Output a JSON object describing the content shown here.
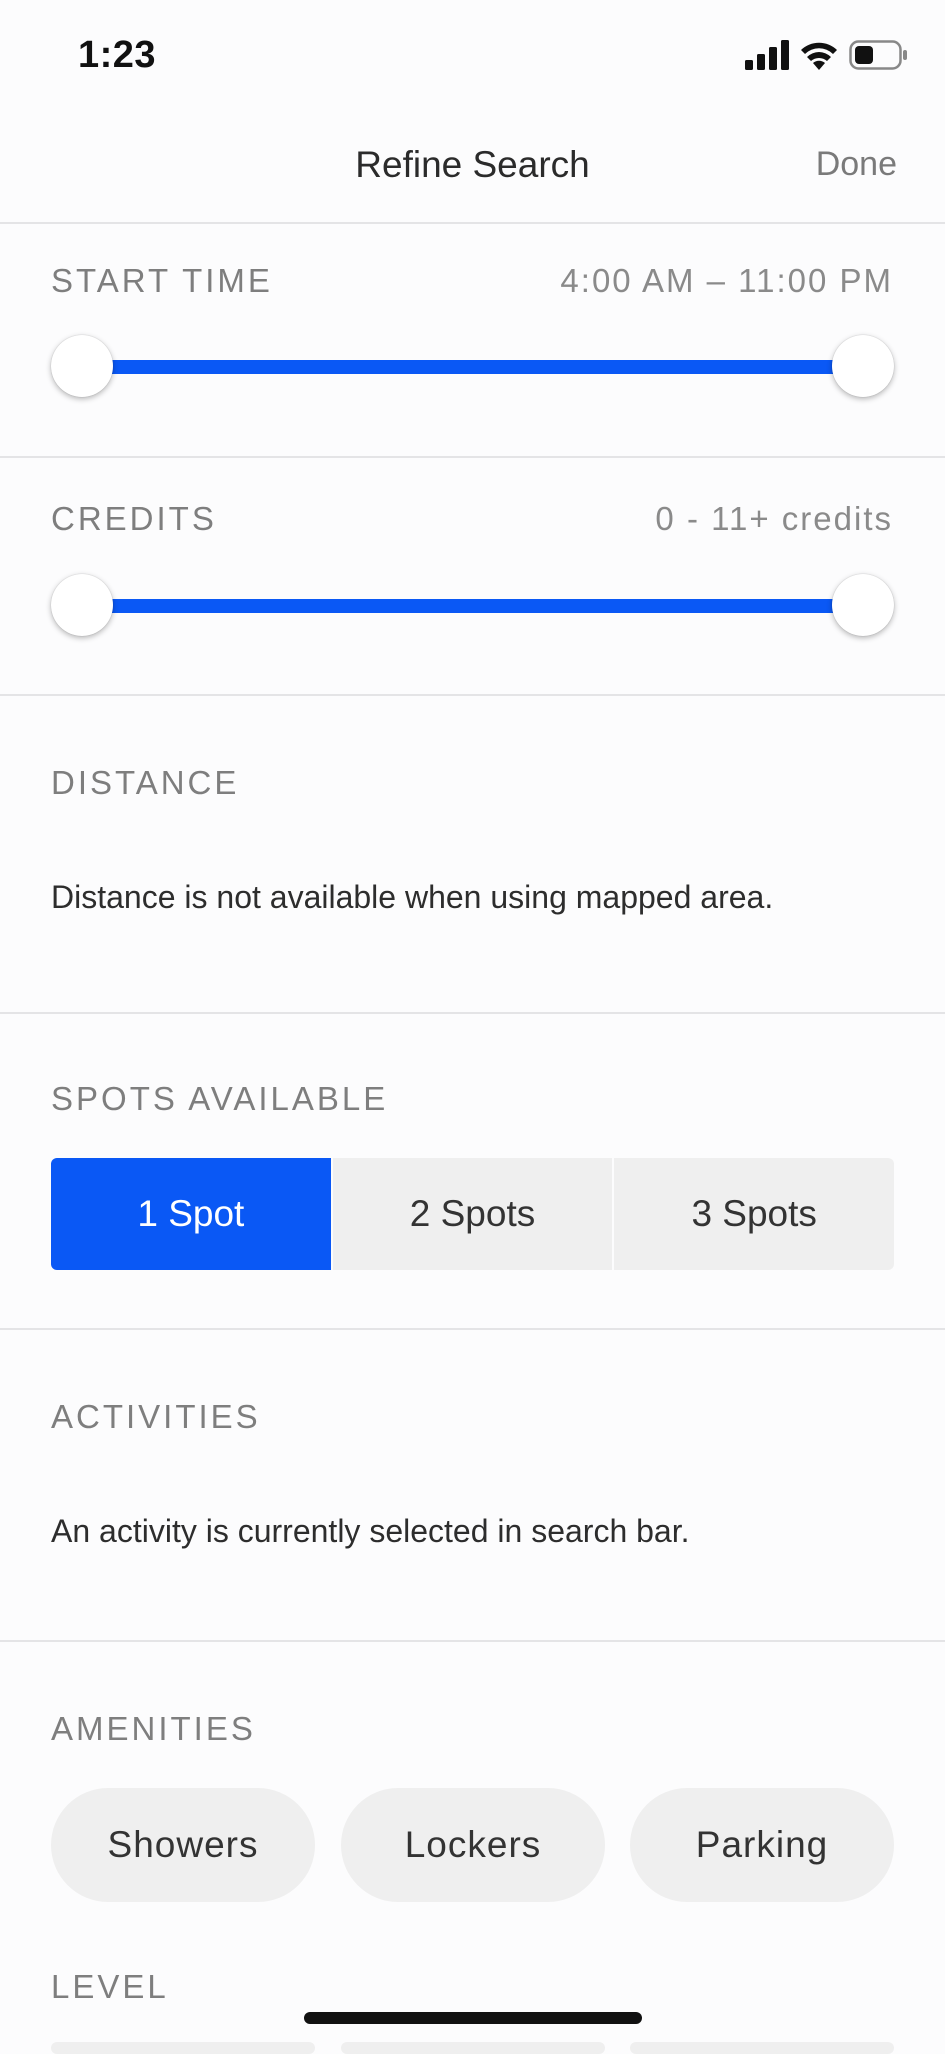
{
  "status_bar": {
    "time": "1:23"
  },
  "nav": {
    "title": "Refine Search",
    "done_label": "Done"
  },
  "start_time": {
    "label": "START TIME",
    "value": "4:00 AM – 11:00 PM",
    "range": [
      0,
      1
    ]
  },
  "credits": {
    "label": "CREDITS",
    "value": "0 - 11+ credits",
    "range": [
      0,
      1
    ]
  },
  "distance": {
    "label": "DISTANCE",
    "message": "Distance is not available when using mapped area."
  },
  "spots": {
    "label": "SPOTS AVAILABLE",
    "options": [
      "1 Spot",
      "2 Spots",
      "3 Spots"
    ],
    "selected": "1 Spot"
  },
  "activities": {
    "label": "ACTIVITIES",
    "message": "An activity is currently selected in search bar."
  },
  "amenities": {
    "label": "AMENITIES",
    "options": [
      "Showers",
      "Lockers",
      "Parking"
    ]
  },
  "level": {
    "label": "LEVEL"
  },
  "colors": {
    "accent": "#0a58f5",
    "chip_bg": "#efefef",
    "divider": "#e4e4e6"
  }
}
